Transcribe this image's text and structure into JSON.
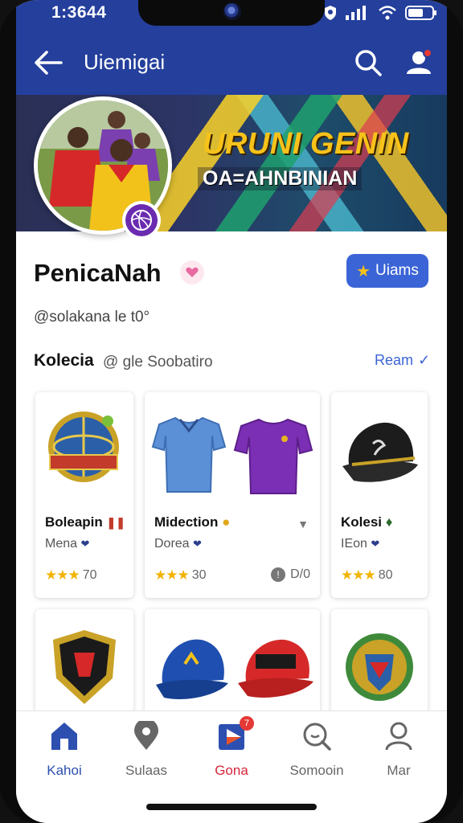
{
  "status_bar": {
    "time": "1:3644"
  },
  "app_bar": {
    "title": "Uiemigai"
  },
  "banner": {
    "headline": "URUNI GENIN",
    "subline": "OA=AHNBINIAN"
  },
  "profile": {
    "name": "PenicaNah",
    "handle": "@solakana le t0°",
    "follow_label": "Uiams"
  },
  "collection": {
    "title": "Kolecia",
    "subtitle": "@ gle Soobatiro",
    "see_all": "Ream"
  },
  "cards": [
    {
      "title": "Boleapin",
      "sub": "Mena",
      "stars": "★★★",
      "rating": "70",
      "extra": ""
    },
    {
      "title": "Midection",
      "sub": "Dorea",
      "stars": "★★★",
      "rating": "30",
      "extra": "D/0"
    },
    {
      "title": "Kolesi",
      "sub": "IEon",
      "stars": "★★★",
      "rating": "80",
      "extra": ""
    }
  ],
  "bottom_nav": [
    {
      "label": "Kahoi",
      "icon": "home-icon"
    },
    {
      "label": "Sulaas",
      "icon": "location-pin-icon"
    },
    {
      "label": "Gona",
      "icon": "play-icon",
      "badge": "7"
    },
    {
      "label": "Somooin",
      "icon": "chat-search-icon"
    },
    {
      "label": "Mar",
      "icon": "person-icon"
    }
  ],
  "colors": {
    "brand": "#243f9c",
    "accent": "#3b64d6",
    "star": "#f2b300",
    "badge": "#e53935"
  }
}
